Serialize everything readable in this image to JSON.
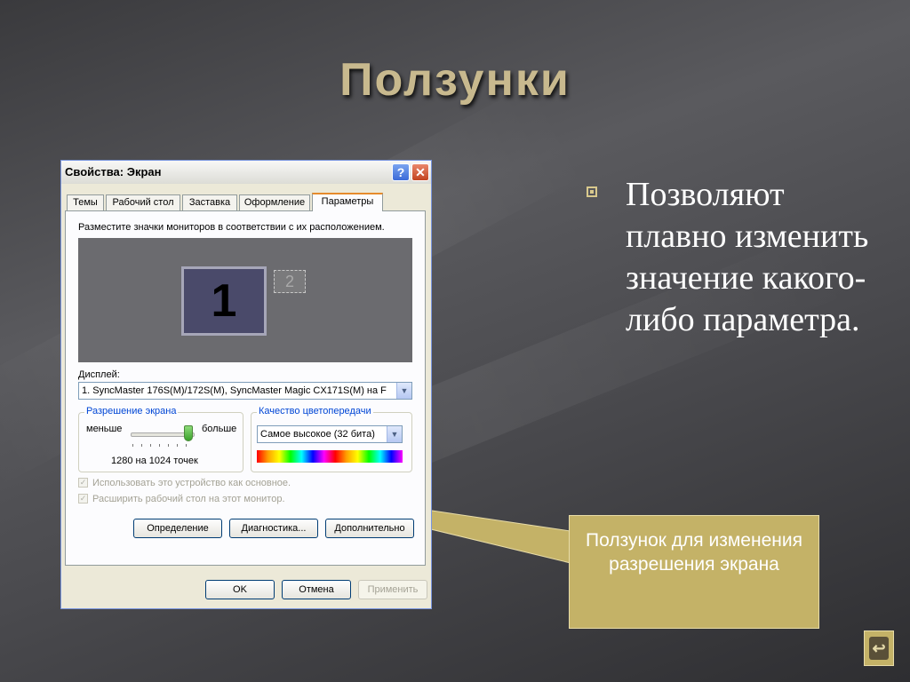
{
  "slide": {
    "title": "Ползунки",
    "bullet": "Позволяют плавно изменить значение какого-либо параметра.",
    "callout": "Ползунок для изменения разрешения экрана",
    "return_icon": "return-arrow-icon"
  },
  "dialog": {
    "title": "Свойства: Экран",
    "help_label": "?",
    "close_label": "✕",
    "tabs": [
      {
        "label": "Темы"
      },
      {
        "label": "Рабочий стол"
      },
      {
        "label": "Заставка"
      },
      {
        "label": "Оформление"
      },
      {
        "label": "Параметры"
      }
    ],
    "active_tab": "Параметры",
    "instruction": "Разместите значки мониторов в соответствии с их расположением.",
    "monitors": [
      {
        "label": "1"
      },
      {
        "label": "2"
      }
    ],
    "display_label": "Дисплей:",
    "display_value": "1. SyncMaster 176S(M)/172S(M), SyncMaster Magic CX171S(M) на F",
    "resolution": {
      "group_title": "Разрешение экрана",
      "less_label": "меньше",
      "more_label": "больше",
      "value_text": "1280 на 1024 точек",
      "slider_position": 1.0
    },
    "color_quality": {
      "group_title": "Качество цветопередачи",
      "selected": "Самое высокое (32 бита)"
    },
    "checkboxes": [
      {
        "label": "Использовать это устройство как основное.",
        "checked": true,
        "disabled": true
      },
      {
        "label": "Расширить рабочий стол на этот монитор.",
        "checked": true,
        "disabled": true
      }
    ],
    "buttons": {
      "identify": "Определение",
      "troubleshoot": "Диагностика...",
      "advanced": "Дополнительно",
      "ok": "OK",
      "cancel": "Отмена",
      "apply": "Применить"
    }
  },
  "colors": {
    "title_gold": "#c8b98e",
    "callout_bg": "#c4b267",
    "xp_face": "#ece9d8",
    "active_tab_accent": "#e68b2c"
  }
}
